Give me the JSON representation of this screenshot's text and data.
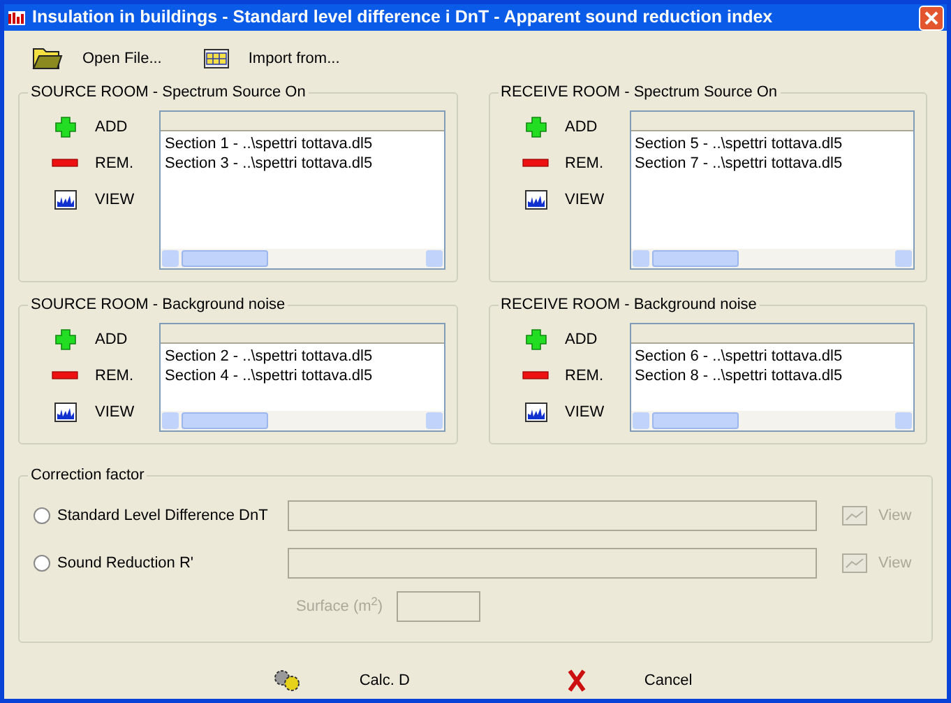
{
  "window": {
    "title": "Insulation in buildings - Standard level difference i DnT - Apparent sound reduction index"
  },
  "toolbar": [
    {
      "kind": "open",
      "label": "Open File..."
    },
    {
      "kind": "import",
      "label": "Import from..."
    }
  ],
  "rooms": [
    {
      "title": "SOURCE ROOM - Spectrum Source On",
      "actions": [
        {
          "kind": "add",
          "label": "ADD"
        },
        {
          "kind": "remove",
          "label": "REM."
        },
        {
          "kind": "view",
          "label": "VIEW"
        }
      ],
      "items": [
        "Section 1 - ..\\spettri tottava.dl5",
        "Section 3 - ..\\spettri tottava.dl5"
      ]
    },
    {
      "title": "RECEIVE ROOM - Spectrum Source On",
      "actions": [
        {
          "kind": "add",
          "label": "ADD"
        },
        {
          "kind": "remove",
          "label": "REM."
        },
        {
          "kind": "view",
          "label": "VIEW"
        }
      ],
      "items": [
        "Section 5 - ..\\spettri tottava.dl5",
        "Section 7 - ..\\spettri tottava.dl5"
      ]
    },
    {
      "title": "SOURCE ROOM - Background noise",
      "actions": [
        {
          "kind": "add",
          "label": "ADD"
        },
        {
          "kind": "remove",
          "label": "REM."
        },
        {
          "kind": "view",
          "label": "VIEW"
        }
      ],
      "items": [
        "Section 2 - ..\\spettri tottava.dl5",
        "Section 4 - ..\\spettri tottava.dl5"
      ]
    },
    {
      "title": "RECEIVE ROOM - Background noise",
      "actions": [
        {
          "kind": "add",
          "label": "ADD"
        },
        {
          "kind": "remove",
          "label": "REM."
        },
        {
          "kind": "view",
          "label": "VIEW"
        }
      ],
      "items": [
        "Section 6 - ..\\spettri tottava.dl5",
        "Section 8 - ..\\spettri tottava.dl5"
      ]
    }
  ],
  "correction": {
    "title": "Correction factor",
    "options": [
      {
        "label": "Standard Level Difference DnT",
        "selected": false,
        "view": "View",
        "view_disabled": true
      },
      {
        "label": "Sound Reduction R'",
        "selected": false,
        "view": "View",
        "view_disabled": true
      }
    ],
    "surface": {
      "label": "Surface (m$^{2}$)",
      "disabled": true
    }
  },
  "buttons": [
    {
      "kind": "calc",
      "label": "Calc. D"
    },
    {
      "kind": "cancel",
      "label": "Cancel"
    }
  ]
}
